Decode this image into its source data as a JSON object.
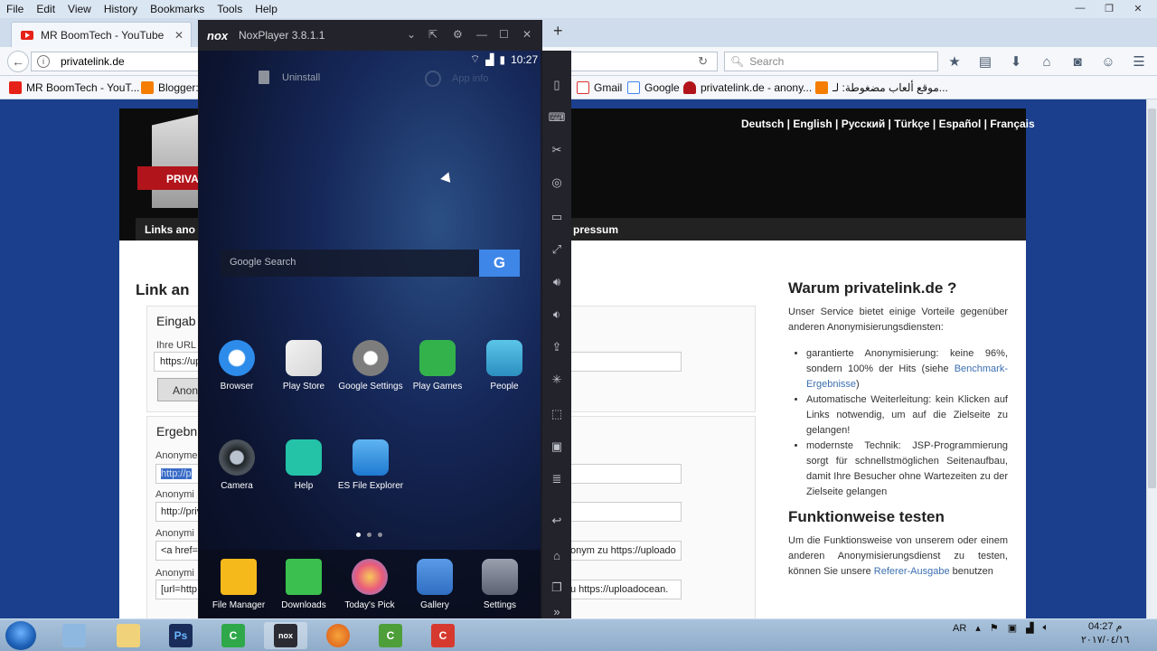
{
  "browser": {
    "menu": [
      "File",
      "Edit",
      "View",
      "History",
      "Bookmarks",
      "Tools",
      "Help"
    ],
    "tab_title": "MR BoomTech - YouTube",
    "url": "privatelink.de",
    "search_placeholder": "Search",
    "bookmarks": [
      "MR BoomTech - YouT...",
      "Blogger:",
      "Gmail",
      "Google",
      "privatelink.de - anony...",
      "موقع ألعاب مضغوطة: لـ..."
    ]
  },
  "site": {
    "languages": "Deutsch | English | Русский | Türkçe | Español | Français",
    "shield_text": "PRIVA",
    "nav_left": "Links ano",
    "nav_right": "pressum",
    "link_title": "Link an",
    "box1_title": "Eingab",
    "box1_label": "Ihre URL",
    "box1_input": "https://up",
    "anon_button": "Anony",
    "box2_title": "Ergebn",
    "results": [
      {
        "label": "Anonyme",
        "value": "http://p"
      },
      {
        "label": "Anonymi",
        "value": "http://priv"
      },
      {
        "label": "Anonymi",
        "value": "<a href=",
        "value2": "onym zu https://uploado"
      },
      {
        "label": "Anonymi",
        "value": "[url=http",
        "value2": "u https://uploadocean."
      }
    ],
    "sidebar": {
      "title": "Warum privatelink.de ?",
      "intro": "Unser Service bietet einige Vorteile gegenüber anderen Anonymisierungsdiensten:",
      "bullets": [
        {
          "text": "garantierte Anonymisierung: keine 96%, sondern 100% der Hits (siehe ",
          "link": "Benchmark-Ergebnisse",
          "tail": ")"
        },
        {
          "text": "Automatische Weiterleitung: kein Klicken auf Links notwendig, um auf die Zielseite zu gelangen!",
          "link": "",
          "tail": ""
        },
        {
          "text": "modernste Technik: JSP-Programmierung sorgt für schnellstmöglichen Seitenaufbau, damit Ihre Besucher ohne Wartezeiten zu der Zielseite gelangen",
          "link": "",
          "tail": ""
        }
      ],
      "title2": "Funktionweise testen",
      "intro2": "Um die Funktionsweise von unserem oder einem anderen Anonymisierungsdienst zu testen, können Sie unsere ",
      "intro2_link": "Referer-Ausgabe",
      "intro2_tail": "benutzen"
    }
  },
  "nox": {
    "title": "NoxPlayer 3.8.1.1",
    "logo": "nox",
    "time": "10:27",
    "uninstall": "Uninstall",
    "app_info": "App info",
    "search_label": "Google Search",
    "apps_row1": [
      "Browser",
      "Play Store",
      "Google Settings",
      "Play Games",
      "People"
    ],
    "apps_row2": [
      "Camera",
      "Help",
      "ES File Explorer"
    ],
    "dock": [
      "File Manager",
      "Downloads",
      "Today's Pick",
      "Gallery",
      "Settings"
    ]
  },
  "taskbar": {
    "lang": "AR",
    "time": "04:27 م",
    "date": "٢٠١٧/٠٤/١٦"
  },
  "colors": {
    "page_bg": "#1b3f8d",
    "nox_bg": "#1b1b22",
    "google_blue": "#3e86e8",
    "shield_red": "#b2141b"
  }
}
